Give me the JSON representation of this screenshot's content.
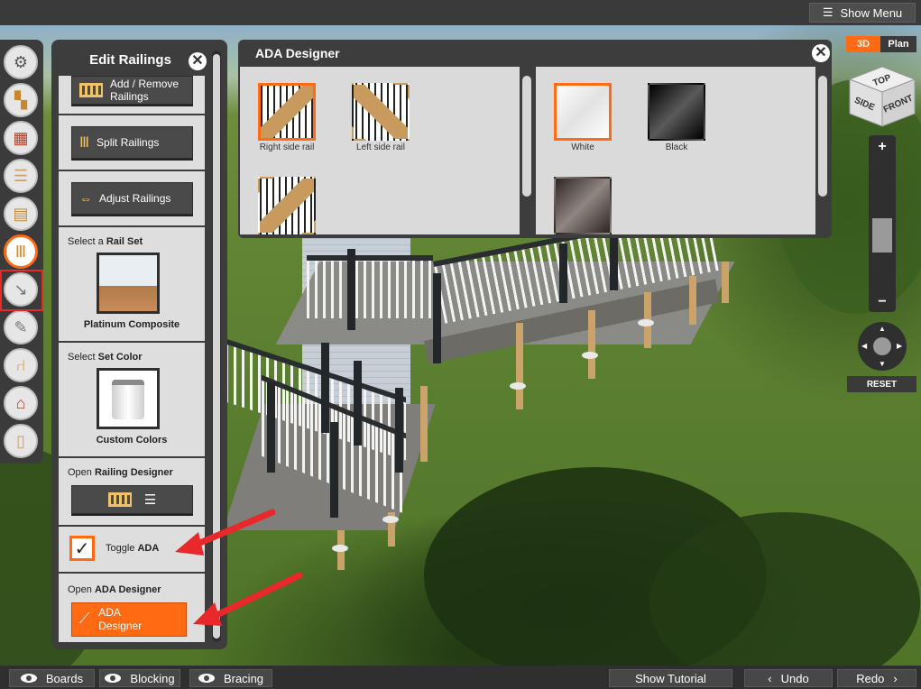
{
  "topbar": {
    "show_menu_label": "Show Menu"
  },
  "toolstrip": {
    "tools": [
      "settings-tool",
      "structure-tool",
      "brick-tool",
      "boards-tool",
      "deck-tool",
      "railings-tool",
      "downspout-tool",
      "screw-tool",
      "furniture-tool",
      "house-tool",
      "document-tool"
    ],
    "active": "railings-tool"
  },
  "edit_panel": {
    "title": "Edit Railings",
    "add_remove_label": "Add / Remove Railings",
    "split_label": "Split Railings",
    "adjust_label": "Adjust Railings",
    "rail_set_prefix": "Select a ",
    "rail_set_bold": "Rail Set",
    "rail_set_value": "Platinum Composite",
    "set_color_prefix": "Select ",
    "set_color_bold": "Set Color",
    "set_color_value": "Custom Colors",
    "railing_designer_prefix": "Open ",
    "railing_designer_bold": "Railing Designer",
    "toggle_ada_prefix": "Toggle ",
    "toggle_ada_bold": "ADA",
    "toggle_ada_checked": true,
    "ada_designer_prefix": "Open ",
    "ada_designer_bold": "ADA Designer",
    "ada_designer_button": "ADA Designer"
  },
  "ada_designer": {
    "title": "ADA Designer",
    "rail_options": [
      {
        "label": "Right side rail",
        "selected": true
      },
      {
        "label": "Left side rail",
        "selected": false
      },
      {
        "label": "",
        "selected": false
      }
    ],
    "color_options": [
      {
        "label": "White",
        "selected": true,
        "color": "#f4f4f4"
      },
      {
        "label": "Black",
        "selected": false,
        "color": "#0a0a0a"
      },
      {
        "label": "",
        "selected": false,
        "color": "#5a504c"
      }
    ]
  },
  "view_controls": {
    "mode_3d": "3D",
    "mode_plan": "Plan",
    "active_mode": "3D",
    "cube_top": "TOP",
    "cube_side": "SIDE",
    "cube_front": "FRONT",
    "zoom_in": "+",
    "zoom_out": "−",
    "reset_label": "RESET"
  },
  "bottombar": {
    "boards_label": "Boards",
    "blocking_label": "Blocking",
    "bracing_label": "Bracing",
    "tutorial_label": "Show Tutorial",
    "undo_label": "Undo",
    "redo_label": "Redo"
  },
  "colors": {
    "accent": "#ff6a13",
    "panel": "#3d3d3d",
    "annotation": "#e8282b"
  }
}
